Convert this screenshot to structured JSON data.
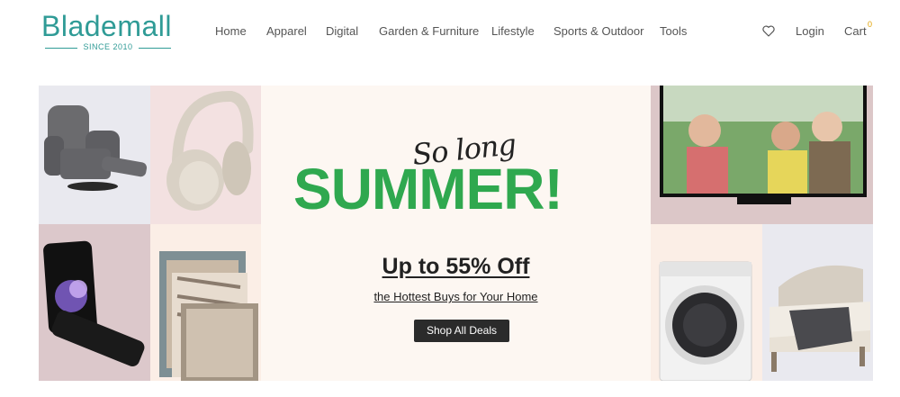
{
  "logo": {
    "word": "Blademall",
    "tagline": "SINCE 2010"
  },
  "nav": {
    "items": [
      "Home",
      "Apparel",
      "Digital",
      "Garden & Furniture",
      "Lifestyle",
      "Sports & Outdoor",
      "Tools"
    ]
  },
  "header_right": {
    "wishlist_icon": "heart-icon",
    "login": "Login",
    "cart": "Cart",
    "cart_count": "0"
  },
  "banner": {
    "script_text": "So long",
    "headline": "SUMMER!",
    "offer": "Up to 55% Off",
    "subline": "the Hottest Buys for Your Home",
    "cta": "Shop All Deals"
  },
  "colors": {
    "brand": "#2f9b96",
    "headline": "#2fa84f",
    "cta_bg": "#2b2b2b",
    "cart_count": "#e2a100"
  },
  "product_images": [
    "recliner-chair",
    "headphones",
    "foldable-phone",
    "area-rugs",
    "television",
    "washing-machine",
    "upholstered-bed"
  ]
}
